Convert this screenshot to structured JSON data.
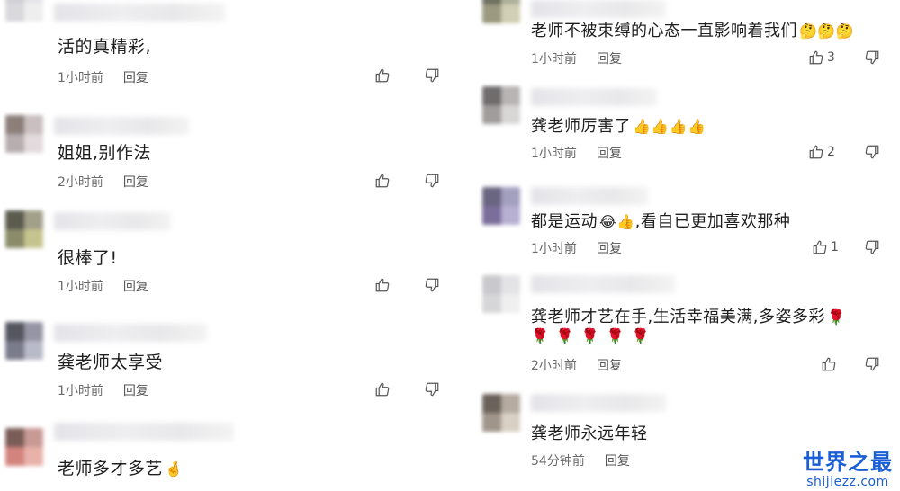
{
  "left_comments": [
    {
      "text": "活的真精彩,",
      "time": "1小时前",
      "reply": "回复"
    },
    {
      "text": "姐姐,别作法",
      "time": "2小时前",
      "reply": "回复"
    },
    {
      "text": "很棒了!",
      "time": "1小时前",
      "reply": "回复"
    },
    {
      "text": "龚老师太享受",
      "time": "1小时前",
      "reply": "回复"
    },
    {
      "text": "老师多才多艺",
      "emoji": "🤞",
      "time": "",
      "reply": ""
    }
  ],
  "right_comments": [
    {
      "text": "老师不被束缚的心态一直影响着我们",
      "emoji": "🤔🤔🤔",
      "time": "1小时前",
      "reply": "回复",
      "likes": "3"
    },
    {
      "text": "龚老师厉害了",
      "emoji": "👍👍👍👍",
      "time": "1小时前",
      "reply": "回复",
      "likes": "2"
    },
    {
      "text": "都是运动",
      "emoji": "😂👍",
      "text2": ",看自已更加喜欢那种",
      "time": "1小时前",
      "reply": "回复",
      "likes": "1"
    },
    {
      "text": "龚老师才艺在手,生活幸福美满,多姿多彩",
      "emoji": "🌹",
      "line2": "🌹🌹🌹🌹🌹",
      "time": "2小时前",
      "reply": "回复",
      "likes": ""
    },
    {
      "text": "龚老师永远年轻",
      "time": "54分钟前",
      "reply": "回复"
    }
  ],
  "watermark": {
    "title": "世界之最",
    "url": "shijiezz.com"
  },
  "icons": {
    "like": "thumbs-up-icon",
    "dislike": "thumbs-down-icon"
  },
  "colors": {
    "text": "#1f1f1f",
    "meta": "#6b6b6b",
    "watermark": "#1b5fd6"
  }
}
